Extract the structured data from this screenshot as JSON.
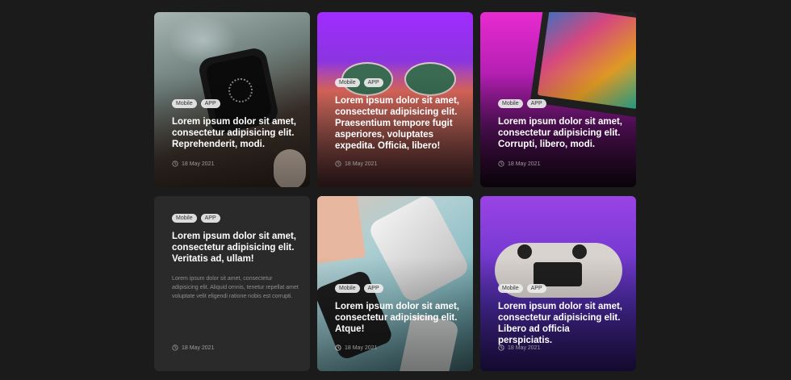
{
  "cards": [
    {
      "tags": [
        "Mobile",
        "APP"
      ],
      "title": "Lorem ipsum dolor sit amet, consectetur adipisicing elit. Reprehenderit, modi.",
      "date": "18 May 2021"
    },
    {
      "tags": [
        "Mobile",
        "APP"
      ],
      "title": "Lorem ipsum dolor sit amet, consectetur adipisicing elit. Praesentium tempore fugit asperiores, voluptates expedita. Officia, libero!",
      "date": "18 May 2021"
    },
    {
      "tags": [
        "Mobile",
        "APP"
      ],
      "title": "Lorem ipsum dolor sit amet, consectetur adipisicing elit. Corrupti, libero, modi.",
      "date": "18 May 2021"
    },
    {
      "tags": [
        "Mobile",
        "APP"
      ],
      "title": "Lorem ipsum dolor sit amet, consectetur adipisicing elit. Veritatis ad, ullam!",
      "description": "Lorem ipsum dolor sit amet, consectetur adipisicing elit. Aliquid omnis, tenetur repellat amet voluptate velit eligendi ratione nobis est corrupti.",
      "date": "18 May 2021"
    },
    {
      "tags": [
        "Mobile",
        "APP"
      ],
      "title": "Lorem ipsum dolor sit amet, consectetur adipisicing elit. Atque!",
      "date": "18 May 2021"
    },
    {
      "tags": [
        "Mobile",
        "APP"
      ],
      "title": "Lorem ipsum dolor sit amet, consectetur adipisicing elit. Libero ad officia perspiciatis.",
      "date": "18 May 2021"
    }
  ],
  "icons": {
    "date": "clock-icon"
  }
}
